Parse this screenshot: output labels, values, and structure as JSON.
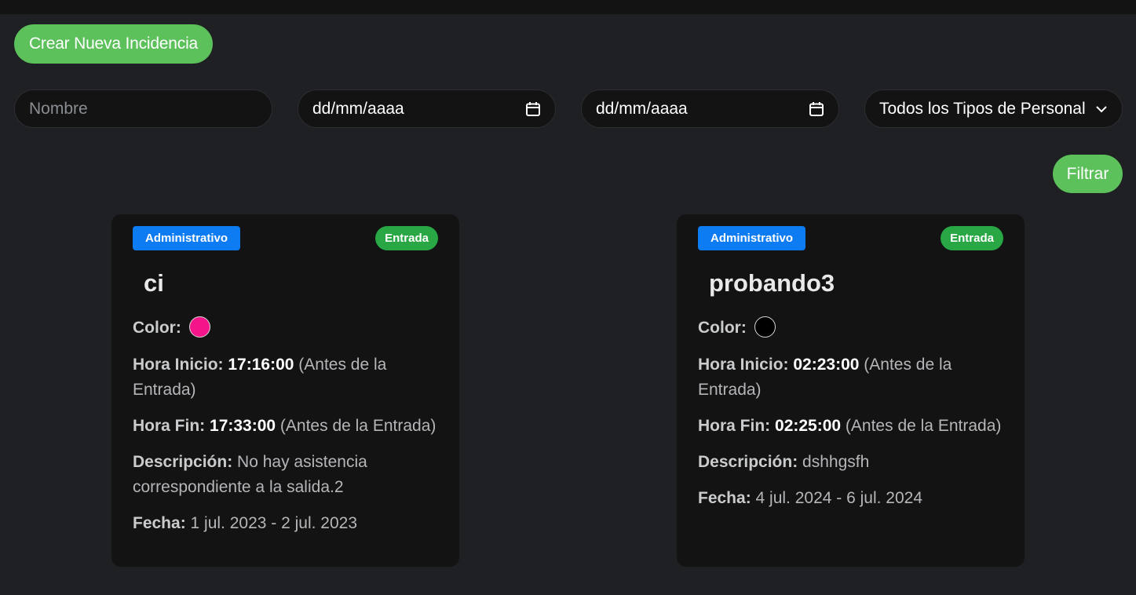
{
  "toolbar": {
    "create_label": "Crear Nueva Incidencia",
    "filter_label": "Filtrar"
  },
  "filters": {
    "name_placeholder": "Nombre",
    "date_start": "dd/mm/aaaa",
    "date_end": "dd/mm/aaaa",
    "personnel_select": "Todos los Tipos de Personal"
  },
  "labels": {
    "color": "Color:",
    "start": "Hora Inicio:",
    "end": "Hora Fin:",
    "description": "Descripción:",
    "date": "Fecha:"
  },
  "cards": [
    {
      "type_badge": "Administrativo",
      "kind_badge": "Entrada",
      "title": "ci",
      "color": "#f4158b",
      "start_time": "17:16:00",
      "start_note": "(Antes de la Entrada)",
      "end_time": "17:33:00",
      "end_note": "(Antes de la Entrada)",
      "description": "No hay asistencia correspondiente a la salida.2",
      "date": "1 jul. 2023 - 2 jul. 2023"
    },
    {
      "type_badge": "Administrativo",
      "kind_badge": "Entrada",
      "title": "probando3",
      "color": "#000000",
      "start_time": "02:23:00",
      "start_note": "(Antes de la Entrada)",
      "end_time": "02:25:00",
      "end_note": "(Antes de la Entrada)",
      "description": "dshhgsfh",
      "date": "4 jul. 2024 - 6 jul. 2024"
    }
  ],
  "colors": {
    "accent_green": "#5cc15b",
    "badge_blue": "#0d7bf2",
    "badge_green": "#28a744",
    "background": "#1e2023",
    "card": "#131313"
  },
  "icons": {
    "calendar": "calendar-icon",
    "chevron": "chevron-down-icon"
  }
}
